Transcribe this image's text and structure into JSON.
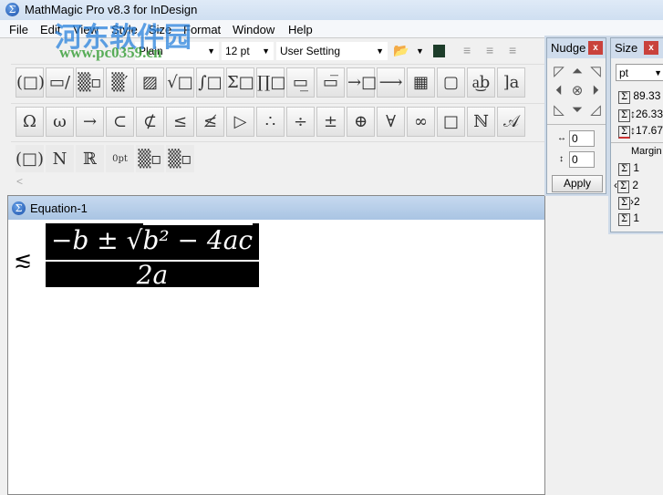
{
  "window": {
    "title": "MathMagic Pro v8.3 for InDesign"
  },
  "menu": [
    "File",
    "Edit",
    "View",
    "Style",
    "Size",
    "Format",
    "Window",
    "Help"
  ],
  "toolbar": {
    "style": "Plain",
    "size": "12 pt",
    "spacing": "User Setting"
  },
  "palette_row1": [
    "(□)",
    "▭/▭",
    "▒▫",
    "▒′",
    "▨",
    "√□",
    "∫□",
    "Σ□",
    "∏□",
    "▭̲",
    "▭̅",
    "→□",
    "⟶",
    "▦",
    "▢",
    "a͜b",
    "]a"
  ],
  "palette_row2": [
    "Ω",
    "ω",
    "→",
    "⊂",
    "⊄",
    "≤",
    "≰",
    "▷",
    "∴",
    "÷",
    "±",
    "⊕",
    "∀",
    "∞",
    "□",
    "ℕ",
    "𝒜"
  ],
  "palette_row3": [
    "(□)",
    "N",
    "ℝ",
    "0pt",
    "▒▫",
    "▒▫"
  ],
  "equation": {
    "title": "Equation-1",
    "left_symbol": "≲",
    "numerator_left": "−b ±",
    "radicand": "b² − 4ac",
    "denominator": "2a"
  },
  "nudge": {
    "title": "Nudge",
    "h_value": "0",
    "v_value": "0",
    "apply": "Apply"
  },
  "size_panel": {
    "title": "Size",
    "unit": "pt",
    "width": "89.33",
    "height": "26.33",
    "depth": "17.67",
    "margin_label": "Margin",
    "margins": [
      "1",
      "2",
      "2",
      "1"
    ]
  },
  "watermark": {
    "name": "河东软件园",
    "url": "www.pc0359.cn"
  }
}
